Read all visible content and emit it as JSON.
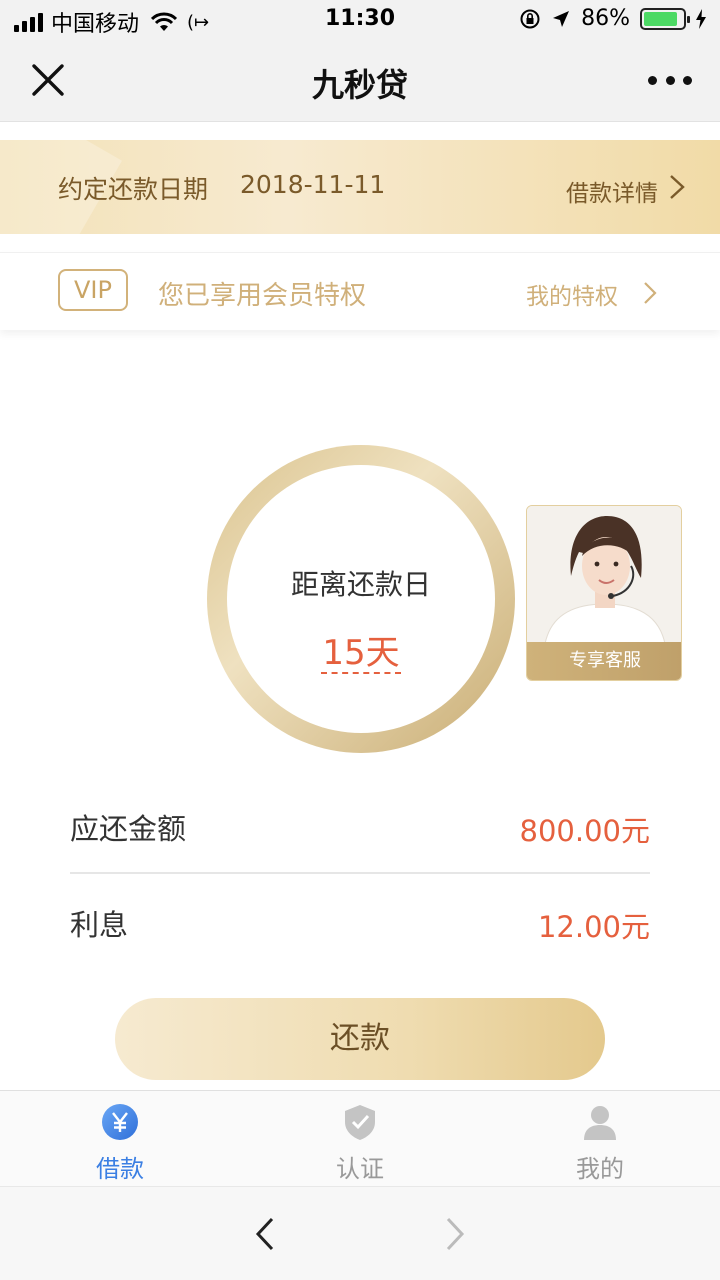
{
  "status_bar": {
    "carrier": "中国移动",
    "time": "11:30",
    "battery": "86%",
    "battery_level": 0.86,
    "icons": [
      "signal-icon",
      "wifi-icon",
      "call-forward-icon",
      "rotation-lock-icon",
      "location-icon",
      "battery-icon",
      "charging-icon"
    ]
  },
  "nav": {
    "title": "九秒贷",
    "icons": [
      "close-icon",
      "more-icon"
    ]
  },
  "due_banner": {
    "label": "约定还款日期",
    "date": "2018-11-11",
    "detail_link": "借款详情"
  },
  "vip": {
    "badge": "VIP",
    "text": "您已享用会员特权",
    "link": "我的特权"
  },
  "countdown": {
    "label": "距离还款日",
    "days": "15天"
  },
  "service": {
    "label": "专享客服"
  },
  "amounts": [
    {
      "label": "应还金额",
      "value": "800.00元"
    },
    {
      "label": "利息",
      "value": "12.00元"
    }
  ],
  "repay_button": "还款",
  "tabs": [
    {
      "label": "借款",
      "icon": "yen-icon",
      "active": true
    },
    {
      "label": "认证",
      "icon": "shield-check-icon",
      "active": false
    },
    {
      "label": "我的",
      "icon": "user-icon",
      "active": false
    }
  ],
  "colors": {
    "accent_gold": "#d0b07a",
    "amount_red": "#e5603e",
    "tab_active_blue": "#3b7fe3"
  }
}
